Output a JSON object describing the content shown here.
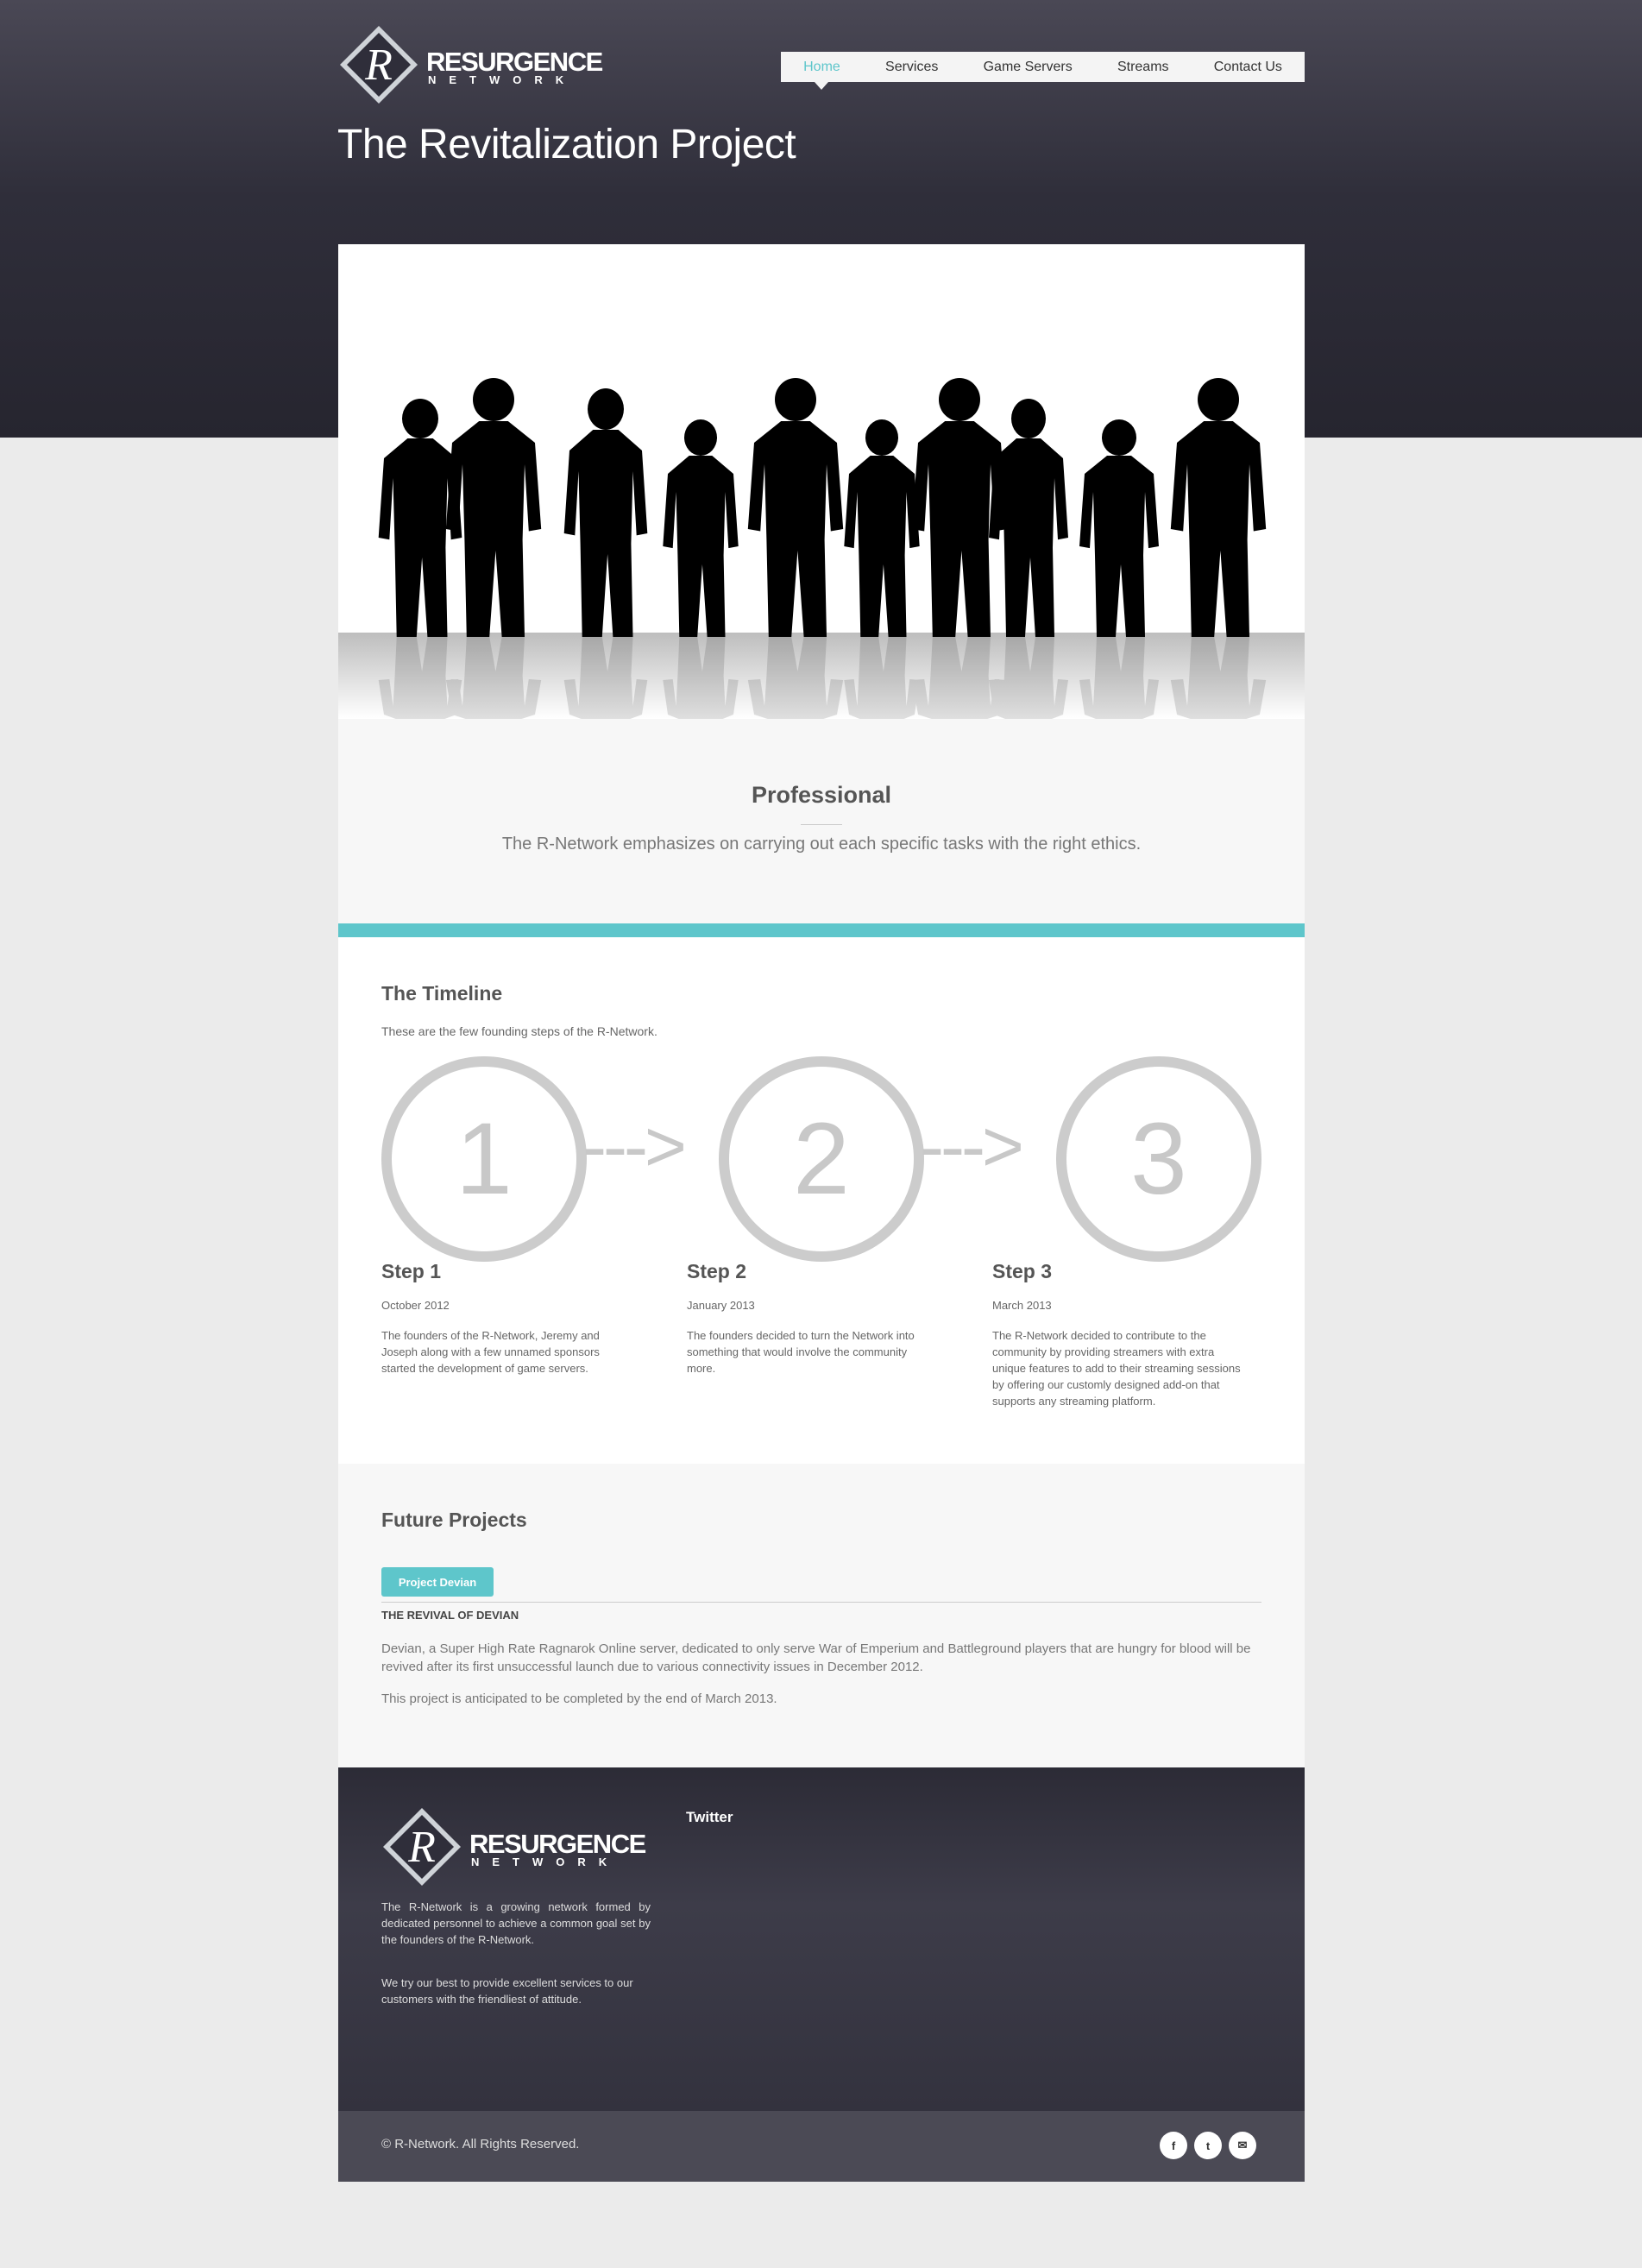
{
  "brand": {
    "logo_letter": "R",
    "name_top": "RESURGENCE",
    "name_bottom": "NETWORK"
  },
  "nav": {
    "items": [
      {
        "label": "Home",
        "active": true
      },
      {
        "label": "Services"
      },
      {
        "label": "Game Servers"
      },
      {
        "label": "Streams"
      },
      {
        "label": "Contact Us"
      }
    ]
  },
  "page_title": "The Revitalization Project",
  "professional": {
    "title": "Professional",
    "text": "The R-Network emphasizes on carrying out each specific tasks with the right ethics."
  },
  "timeline": {
    "title": "The Timeline",
    "lead": "These are the few founding steps of the R-Network.",
    "arrow": "--->",
    "steps": [
      {
        "number": "1",
        "title": "Step 1",
        "date": "October 2012",
        "desc": "The founders of the R-Network, Jeremy and Joseph along with a few unnamed sponsors started the development of game servers."
      },
      {
        "number": "2",
        "title": "Step 2",
        "date": "January 2013",
        "desc": "The founders decided to turn the Network into something that would involve the community more."
      },
      {
        "number": "3",
        "title": "Step 3",
        "date": "March 2013",
        "desc": "The R-Network decided to contribute to the community by providing streamers with extra unique features to add to their streaming sessions by offering our customly designed add-on that supports any streaming platform."
      }
    ]
  },
  "future": {
    "title": "Future Projects",
    "tab_label": "Project Devian",
    "subhead": "THE REVIVAL OF DEVIAN",
    "para1": "Devian, a Super High Rate Ragnarok Online server, dedicated to only serve War of Emperium and Battleground players that are hungry for blood will be revived after its first unsuccessful launch due to various connectivity issues in December 2012.",
    "para2": "This project is anticipated to be completed by the end of March 2013."
  },
  "footer": {
    "about1": "The R-Network is a growing network formed by dedicated personnel to achieve a common goal set by the founders of the R-Network.",
    "about2": "We try our best to provide excellent services to our customers with the friendliest of attitude.",
    "twitter_title": "Twitter",
    "copyright": "© R-Network. All Rights Reserved.",
    "social": [
      {
        "icon": "facebook-icon",
        "glyph": "f"
      },
      {
        "icon": "twitter-icon",
        "glyph": "t"
      },
      {
        "icon": "email-icon",
        "glyph": "✉"
      }
    ]
  },
  "colors": {
    "accent": "#5ec6cb",
    "header_dark": "#2f2e3a",
    "page_bg": "#ebebeb"
  }
}
